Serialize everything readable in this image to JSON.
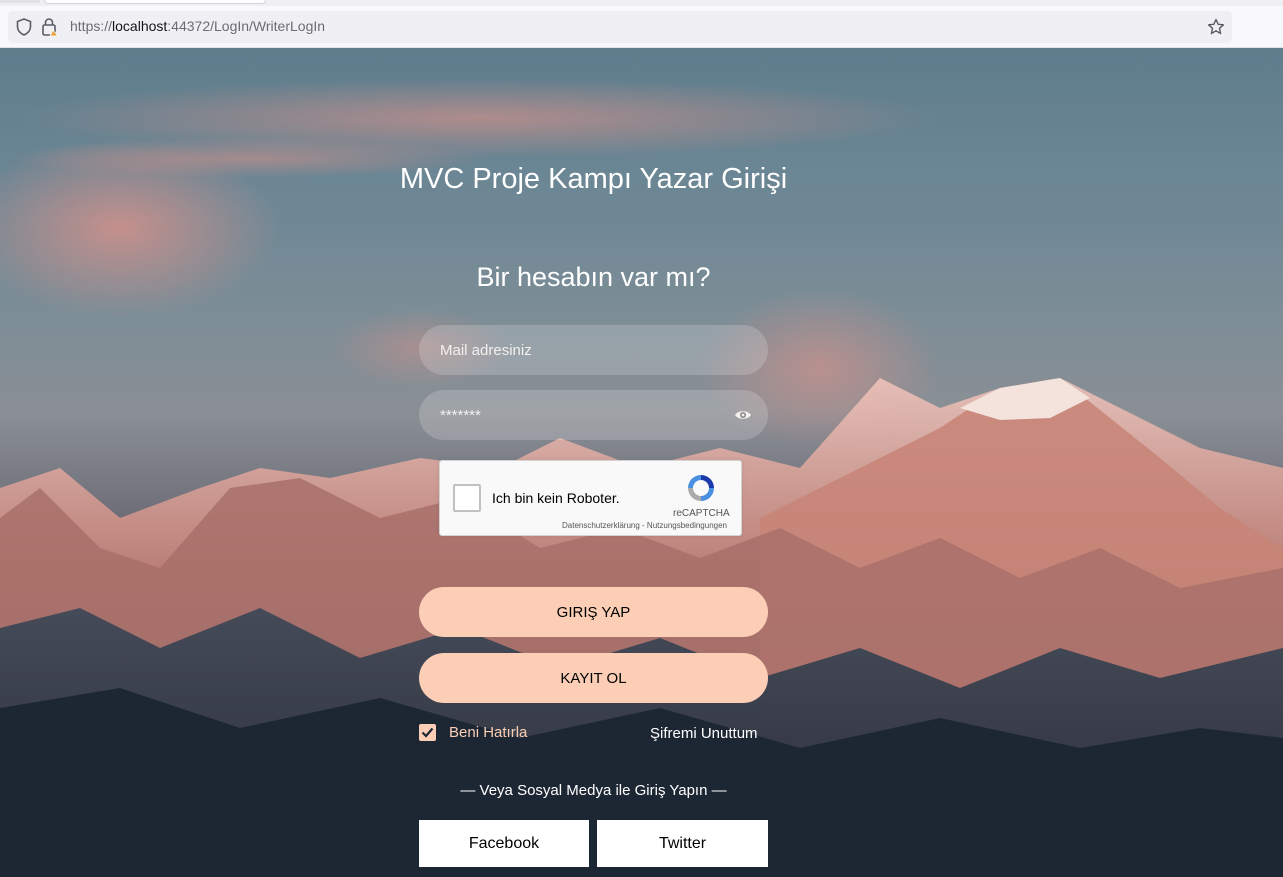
{
  "browser": {
    "url_prefix": "https://",
    "url_host": "localhost",
    "url_rest": ":44372/LogIn/WriterLogIn"
  },
  "page": {
    "title": "MVC Proje Kampı Yazar Girişi",
    "subtitle": "Bir hesabın var mı?",
    "mail_placeholder": "Mail adresiniz",
    "password_value": "*******",
    "captcha": {
      "label": "Ich bin kein Roboter.",
      "brand": "reCAPTCHA",
      "links": "Datenschutzerklärung - Nutzungsbedingungen"
    },
    "login_button": "GIRIŞ YAP",
    "register_button": "KAYIT OL",
    "remember_label": "Beni Hatırla",
    "remember_checked": true,
    "forgot_label": "Şifremi Unuttum",
    "social_divider": "— Veya Sosyal Medya ile Giriş Yapın —",
    "facebook_label": "Facebook",
    "twitter_label": "Twitter"
  },
  "colors": {
    "accent": "#fbceb5",
    "text_light": "#ffffff"
  },
  "icons": [
    "shield-icon",
    "lock-icon",
    "star-icon",
    "eye-icon",
    "recaptcha-logo-icon",
    "checkmark-icon"
  ]
}
